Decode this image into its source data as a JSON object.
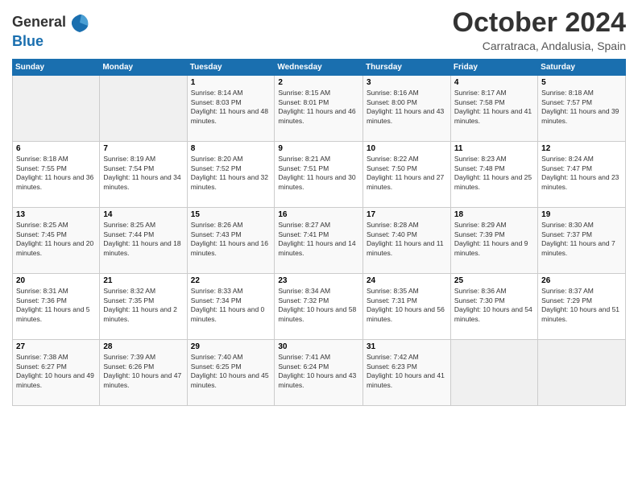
{
  "header": {
    "logo_general": "General",
    "logo_blue": "Blue",
    "month": "October 2024",
    "location": "Carratraca, Andalusia, Spain"
  },
  "days_of_week": [
    "Sunday",
    "Monday",
    "Tuesday",
    "Wednesday",
    "Thursday",
    "Friday",
    "Saturday"
  ],
  "weeks": [
    [
      {
        "day": "",
        "info": ""
      },
      {
        "day": "",
        "info": ""
      },
      {
        "day": "1",
        "info": "Sunrise: 8:14 AM\nSunset: 8:03 PM\nDaylight: 11 hours and 48 minutes."
      },
      {
        "day": "2",
        "info": "Sunrise: 8:15 AM\nSunset: 8:01 PM\nDaylight: 11 hours and 46 minutes."
      },
      {
        "day": "3",
        "info": "Sunrise: 8:16 AM\nSunset: 8:00 PM\nDaylight: 11 hours and 43 minutes."
      },
      {
        "day": "4",
        "info": "Sunrise: 8:17 AM\nSunset: 7:58 PM\nDaylight: 11 hours and 41 minutes."
      },
      {
        "day": "5",
        "info": "Sunrise: 8:18 AM\nSunset: 7:57 PM\nDaylight: 11 hours and 39 minutes."
      }
    ],
    [
      {
        "day": "6",
        "info": "Sunrise: 8:18 AM\nSunset: 7:55 PM\nDaylight: 11 hours and 36 minutes."
      },
      {
        "day": "7",
        "info": "Sunrise: 8:19 AM\nSunset: 7:54 PM\nDaylight: 11 hours and 34 minutes."
      },
      {
        "day": "8",
        "info": "Sunrise: 8:20 AM\nSunset: 7:52 PM\nDaylight: 11 hours and 32 minutes."
      },
      {
        "day": "9",
        "info": "Sunrise: 8:21 AM\nSunset: 7:51 PM\nDaylight: 11 hours and 30 minutes."
      },
      {
        "day": "10",
        "info": "Sunrise: 8:22 AM\nSunset: 7:50 PM\nDaylight: 11 hours and 27 minutes."
      },
      {
        "day": "11",
        "info": "Sunrise: 8:23 AM\nSunset: 7:48 PM\nDaylight: 11 hours and 25 minutes."
      },
      {
        "day": "12",
        "info": "Sunrise: 8:24 AM\nSunset: 7:47 PM\nDaylight: 11 hours and 23 minutes."
      }
    ],
    [
      {
        "day": "13",
        "info": "Sunrise: 8:25 AM\nSunset: 7:45 PM\nDaylight: 11 hours and 20 minutes."
      },
      {
        "day": "14",
        "info": "Sunrise: 8:25 AM\nSunset: 7:44 PM\nDaylight: 11 hours and 18 minutes."
      },
      {
        "day": "15",
        "info": "Sunrise: 8:26 AM\nSunset: 7:43 PM\nDaylight: 11 hours and 16 minutes."
      },
      {
        "day": "16",
        "info": "Sunrise: 8:27 AM\nSunset: 7:41 PM\nDaylight: 11 hours and 14 minutes."
      },
      {
        "day": "17",
        "info": "Sunrise: 8:28 AM\nSunset: 7:40 PM\nDaylight: 11 hours and 11 minutes."
      },
      {
        "day": "18",
        "info": "Sunrise: 8:29 AM\nSunset: 7:39 PM\nDaylight: 11 hours and 9 minutes."
      },
      {
        "day": "19",
        "info": "Sunrise: 8:30 AM\nSunset: 7:37 PM\nDaylight: 11 hours and 7 minutes."
      }
    ],
    [
      {
        "day": "20",
        "info": "Sunrise: 8:31 AM\nSunset: 7:36 PM\nDaylight: 11 hours and 5 minutes."
      },
      {
        "day": "21",
        "info": "Sunrise: 8:32 AM\nSunset: 7:35 PM\nDaylight: 11 hours and 2 minutes."
      },
      {
        "day": "22",
        "info": "Sunrise: 8:33 AM\nSunset: 7:34 PM\nDaylight: 11 hours and 0 minutes."
      },
      {
        "day": "23",
        "info": "Sunrise: 8:34 AM\nSunset: 7:32 PM\nDaylight: 10 hours and 58 minutes."
      },
      {
        "day": "24",
        "info": "Sunrise: 8:35 AM\nSunset: 7:31 PM\nDaylight: 10 hours and 56 minutes."
      },
      {
        "day": "25",
        "info": "Sunrise: 8:36 AM\nSunset: 7:30 PM\nDaylight: 10 hours and 54 minutes."
      },
      {
        "day": "26",
        "info": "Sunrise: 8:37 AM\nSunset: 7:29 PM\nDaylight: 10 hours and 51 minutes."
      }
    ],
    [
      {
        "day": "27",
        "info": "Sunrise: 7:38 AM\nSunset: 6:27 PM\nDaylight: 10 hours and 49 minutes."
      },
      {
        "day": "28",
        "info": "Sunrise: 7:39 AM\nSunset: 6:26 PM\nDaylight: 10 hours and 47 minutes."
      },
      {
        "day": "29",
        "info": "Sunrise: 7:40 AM\nSunset: 6:25 PM\nDaylight: 10 hours and 45 minutes."
      },
      {
        "day": "30",
        "info": "Sunrise: 7:41 AM\nSunset: 6:24 PM\nDaylight: 10 hours and 43 minutes."
      },
      {
        "day": "31",
        "info": "Sunrise: 7:42 AM\nSunset: 6:23 PM\nDaylight: 10 hours and 41 minutes."
      },
      {
        "day": "",
        "info": ""
      },
      {
        "day": "",
        "info": ""
      }
    ]
  ]
}
